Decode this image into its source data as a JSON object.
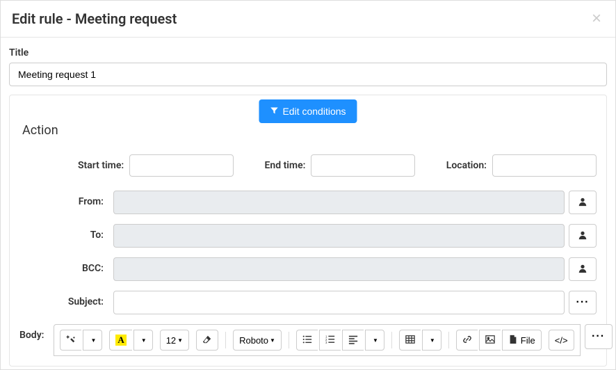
{
  "header": {
    "title": "Edit rule - Meeting request"
  },
  "titleSection": {
    "label": "Title",
    "value": "Meeting request 1"
  },
  "editConditions": "Edit conditions",
  "actionHeading": "Action",
  "timeRow": {
    "startLabel": "Start time:",
    "startValue": "",
    "endLabel": "End time:",
    "endValue": "",
    "locationLabel": "Location:",
    "locationValue": ""
  },
  "fields": {
    "from": {
      "label": "From:",
      "value": ""
    },
    "to": {
      "label": "To:",
      "value": ""
    },
    "bcc": {
      "label": "BCC:",
      "value": ""
    },
    "subject": {
      "label": "Subject:",
      "value": ""
    },
    "body": {
      "label": "Body:"
    }
  },
  "toolbar": {
    "fontSize": "12",
    "fontFamily": "Roboto",
    "file": "File"
  }
}
